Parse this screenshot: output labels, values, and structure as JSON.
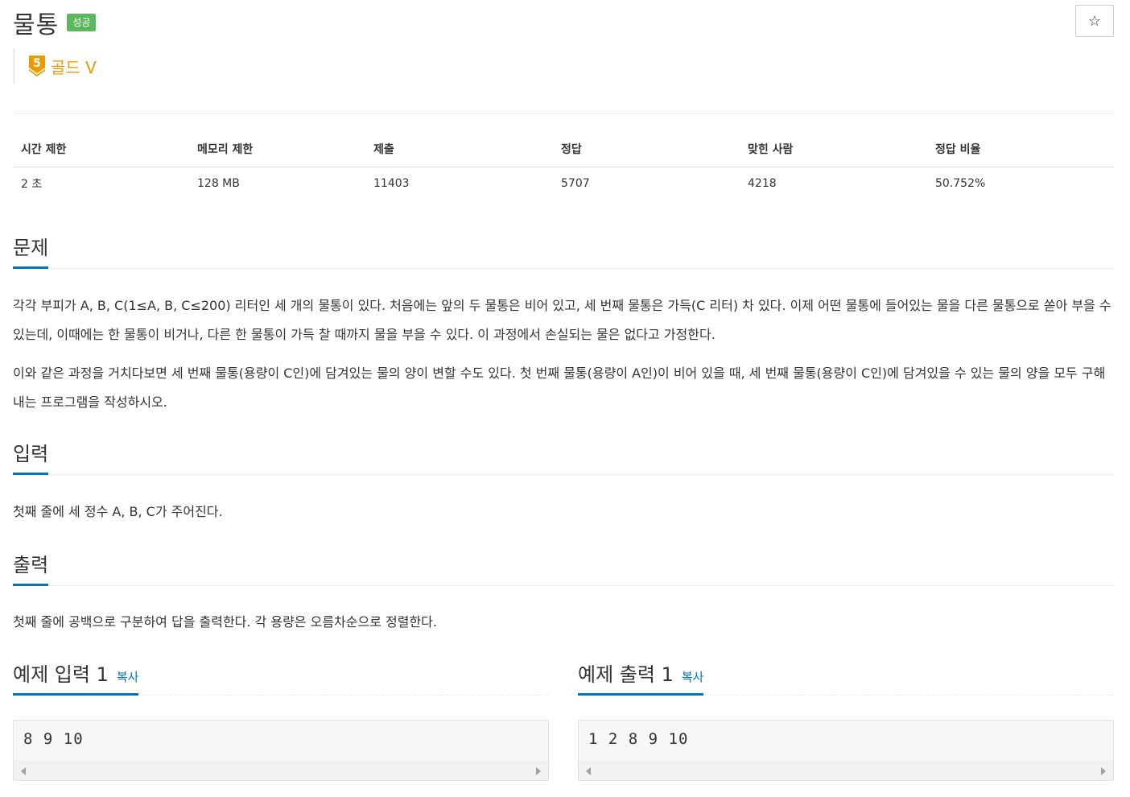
{
  "header": {
    "title": "물통",
    "status_badge": "성공",
    "star_icon": "☆",
    "tier_label": "골드 V",
    "tier_number": "5",
    "tier_color": "#ec9a00"
  },
  "info_table": {
    "headers": [
      "시간 제한",
      "메모리 제한",
      "제출",
      "정답",
      "맞힌 사람",
      "정답 비율"
    ],
    "values": [
      "2 초",
      "128 MB",
      "11403",
      "5707",
      "4218",
      "50.752%"
    ]
  },
  "sections": {
    "problem": {
      "title": "문제",
      "paragraphs": [
        "각각 부피가 A, B, C(1≤A, B, C≤200) 리터인 세 개의 물통이 있다. 처음에는 앞의 두 물통은 비어 있고, 세 번째 물통은 가득(C 리터) 차 있다. 이제 어떤 물통에 들어있는 물을 다른 물통으로 쏟아 부을 수 있는데, 이때에는 한 물통이 비거나, 다른 한 물통이 가득 찰 때까지 물을 부을 수 있다. 이 과정에서 손실되는 물은 없다고 가정한다.",
        "이와 같은 과정을 거치다보면 세 번째 물통(용량이 C인)에 담겨있는 물의 양이 변할 수도 있다. 첫 번째 물통(용량이 A인)이 비어 있을 때, 세 번째 물통(용량이 C인)에 담겨있을 수 있는 물의 양을 모두 구해내는 프로그램을 작성하시오."
      ]
    },
    "input": {
      "title": "입력",
      "text": "첫째 줄에 세 정수 A, B, C가 주어진다."
    },
    "output": {
      "title": "출력",
      "text": "첫째 줄에 공백으로 구분하여 답을 출력한다. 각 용량은 오름차순으로 정렬한다."
    }
  },
  "samples": {
    "input": {
      "title": "예제 입력 1",
      "copy_label": "복사",
      "content": "8 9 10"
    },
    "output": {
      "title": "예제 출력 1",
      "copy_label": "복사",
      "content": "1 2 8 9 10"
    }
  },
  "colors": {
    "success": "#5cb85c",
    "accent": "#0076c0",
    "gold": "#ec9a00"
  }
}
